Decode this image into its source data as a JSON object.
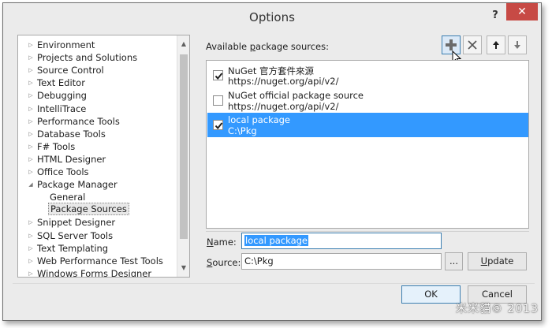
{
  "window": {
    "title": "Options",
    "help_label": "?",
    "close_label": "✕"
  },
  "tree": {
    "items": [
      {
        "label": "Environment",
        "expanded": false
      },
      {
        "label": "Projects and Solutions",
        "expanded": false
      },
      {
        "label": "Source Control",
        "expanded": false
      },
      {
        "label": "Text Editor",
        "expanded": false
      },
      {
        "label": "Debugging",
        "expanded": false
      },
      {
        "label": "IntelliTrace",
        "expanded": false
      },
      {
        "label": "Performance Tools",
        "expanded": false
      },
      {
        "label": "Database Tools",
        "expanded": false
      },
      {
        "label": "F# Tools",
        "expanded": false
      },
      {
        "label": "HTML Designer",
        "expanded": false
      },
      {
        "label": "Office Tools",
        "expanded": false
      },
      {
        "label": "Package Manager",
        "expanded": true
      },
      {
        "label": "General",
        "child": true
      },
      {
        "label": "Package Sources",
        "child": true,
        "selected": true
      },
      {
        "label": "Snippet Designer",
        "expanded": false
      },
      {
        "label": "SQL Server Tools",
        "expanded": false
      },
      {
        "label": "Text Templating",
        "expanded": false
      },
      {
        "label": "Web Performance Test Tools",
        "expanded": false
      },
      {
        "label": "Windows Forms Designer",
        "expanded": false
      }
    ]
  },
  "sources_panel": {
    "label_prefix": "Available ",
    "label_accel": "p",
    "label_suffix": "ackage sources:",
    "toolbar": {
      "add_icon": "plus-icon",
      "remove_icon": "remove-x-icon",
      "move_up_icon": "arrow-up-icon",
      "move_down_icon": "arrow-down-icon"
    },
    "sources": [
      {
        "name": "NuGet 官方套件來源",
        "url": "https://nuget.org/api/v2/",
        "checked": true,
        "selected": false
      },
      {
        "name": "NuGet official package source",
        "url": "https://nuget.org/api/v2/",
        "checked": false,
        "selected": false
      },
      {
        "name": "local package",
        "url": "C:\\Pkg",
        "checked": true,
        "selected": true
      }
    ]
  },
  "form": {
    "name_accel": "N",
    "name_rest": "ame:",
    "name_value": "local package",
    "source_accel": "S",
    "source_rest": "ource:",
    "source_value": "C:\\Pkg",
    "browse_label": "...",
    "update_accel": "U",
    "update_rest": "pdate"
  },
  "footer": {
    "ok_label": "OK",
    "cancel_label": "Cancel"
  },
  "watermark": "米米貓© 2013",
  "colors": {
    "selection": "#3399ff",
    "close_button": "#c74a45",
    "accent_border": "#3c7fb1"
  }
}
